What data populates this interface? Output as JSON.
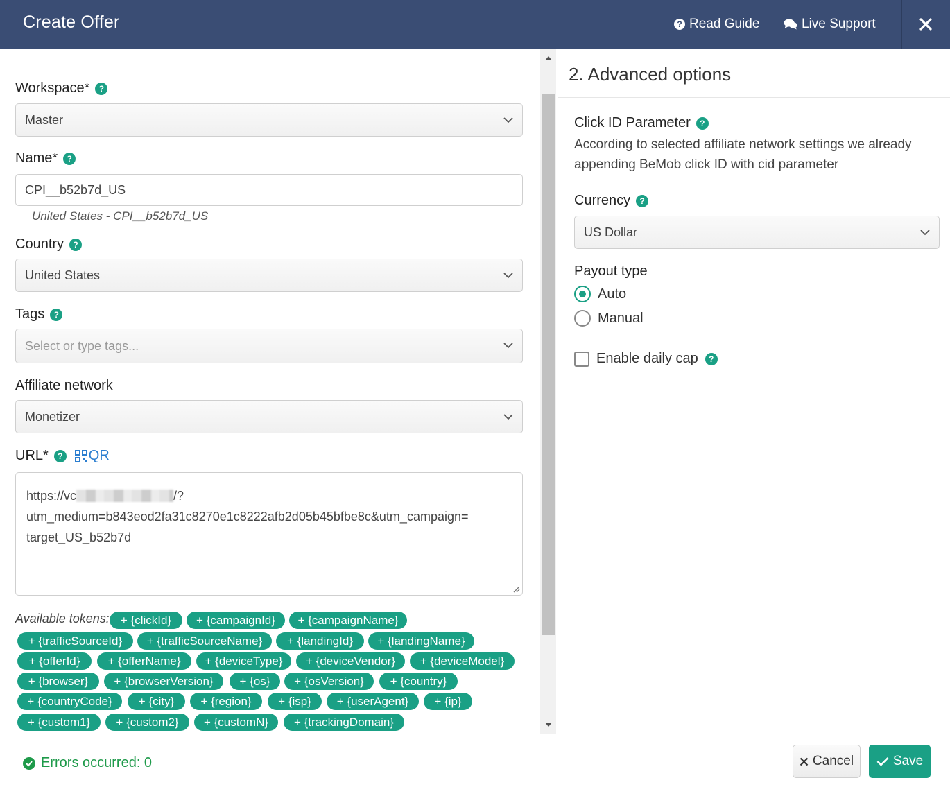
{
  "header": {
    "title": "Create Offer",
    "read_guide": "Read Guide",
    "live_support": "Live Support"
  },
  "form": {
    "workspace": {
      "label": "Workspace*",
      "value": "Master"
    },
    "name": {
      "label": "Name*",
      "value": "CPI__b52b7d_US",
      "hint": "United States - CPI__b52b7d_US"
    },
    "country": {
      "label": "Country",
      "value": "United States"
    },
    "tags": {
      "label": "Tags",
      "placeholder": "Select or type tags..."
    },
    "affiliate_network": {
      "label": "Affiliate network",
      "value": "Monetizer"
    },
    "url": {
      "label": "URL*",
      "qr_label": "QR",
      "line1_start": "https://vc",
      "line1_end": "/?",
      "line2": "utm_medium=b843eod2fa31c8270e1c8222afb2d05b45bfbe8c&utm_campaign=",
      "line3": "target_US_b52b7d"
    },
    "tokens_label": "Available tokens:",
    "tokens": [
      "+ {clickId}",
      "+ {campaignId}",
      "+ {campaignName}",
      "+ {trafficSourceId}",
      "+ {trafficSourceName}",
      "+ {landingId}",
      "+ {landingName}",
      "+ {offerId}",
      "+ {offerName}",
      "+ {deviceType}",
      "+ {deviceVendor}",
      "+ {deviceModel}",
      "+ {browser}",
      "+ {browserVersion}",
      "+ {os}",
      "+ {osVersion}",
      "+ {country}",
      "+ {countryCode}",
      "+ {city}",
      "+ {region}",
      "+ {isp}",
      "+ {userAgent}",
      "+ {ip}",
      "+ {custom1}",
      "+ {custom2}",
      "+ {customN}",
      "+ {trackingDomain}"
    ]
  },
  "advanced": {
    "title": "2. Advanced options",
    "click_id_label": "Click ID Parameter",
    "click_id_text": "According to selected affiliate network settings we already appending BeMob click ID with cid parameter",
    "currency_label": "Currency",
    "currency_value": "US Dollar",
    "payout_type_label": "Payout type",
    "payout_options": [
      "Auto",
      "Manual"
    ],
    "payout_selected": "Auto",
    "daily_cap_label": "Enable daily cap",
    "daily_cap_checked": false
  },
  "footer": {
    "errors_text": "Errors occurred: 0",
    "cancel_label": "Cancel",
    "save_label": "Save"
  },
  "colors": {
    "header_bg": "#3a4d74",
    "accent": "#1aa085",
    "link": "#2b7ed0",
    "success": "#1e9a4a"
  },
  "icons": [
    "question-circle-icon",
    "chat-bubbles-icon",
    "close-icon",
    "help-icon",
    "qr-code-icon",
    "chevron-down-icon",
    "check-circle-icon",
    "times-icon",
    "check-icon"
  ]
}
